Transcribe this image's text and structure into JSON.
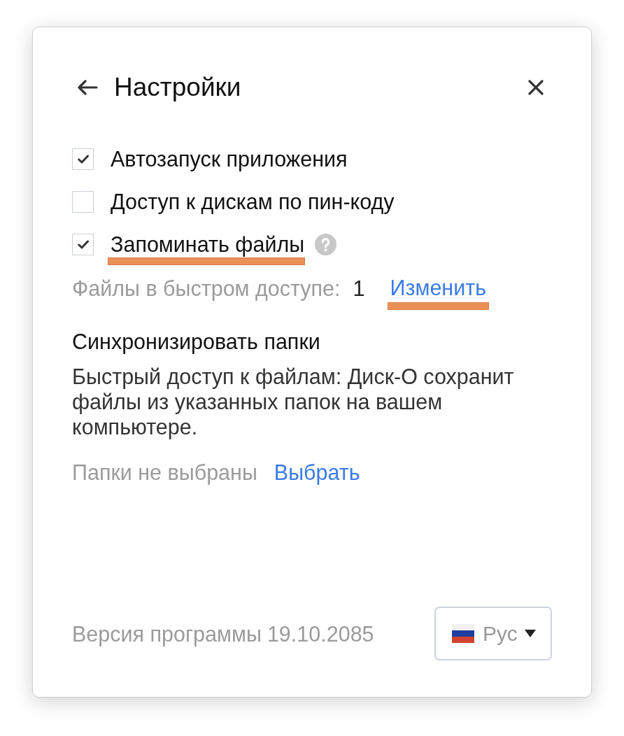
{
  "header": {
    "title": "Настройки"
  },
  "options": [
    {
      "label": "Автозапуск приложения",
      "checked": true,
      "highlighted": false,
      "has_help": false
    },
    {
      "label": "Доступ к дискам по пин-коду",
      "checked": false,
      "highlighted": false,
      "has_help": false
    },
    {
      "label": "Запоминать файлы",
      "checked": true,
      "highlighted": true,
      "has_help": true
    }
  ],
  "quick_access": {
    "label": "Файлы в быстром доступе:",
    "count": "1",
    "link": {
      "label": "Изменить",
      "highlighted": true
    }
  },
  "sync": {
    "title": "Синхронизировать папки",
    "description": "Быстрый доступ к файлам: Диск-О сохранит файлы из указанных папок на вашем компьютере.",
    "status": "Папки не выбраны",
    "link": "Выбрать"
  },
  "footer": {
    "version_label": "Версия программы",
    "version": "19.10.2085",
    "language": {
      "label": "Рус"
    }
  }
}
